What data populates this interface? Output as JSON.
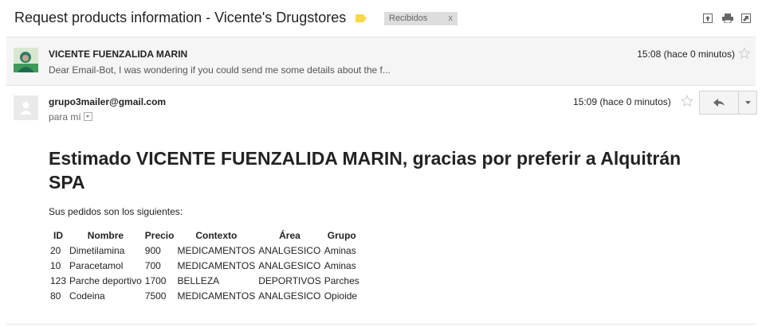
{
  "subject": "Request products information - Vicente's Drugstores",
  "label": {
    "name": "Recibidos",
    "close": "x"
  },
  "colors": {
    "label_tag": "#f9d84a",
    "star": "#cfcfcf",
    "chip_bg": "#dddddd"
  },
  "icons": [
    "new-window-icon",
    "print-icon",
    "popout-icon",
    "star-icon",
    "reply-icon",
    "chevron-down-icon"
  ],
  "thread": [
    {
      "sender": "VICENTE FUENZALIDA MARIN",
      "time": "15:08 (hace 0 minutos)",
      "snippet": "Dear Email-Bot, I was wondering if you could send me some details about the f..."
    },
    {
      "sender": "grupo3mailer@gmail.com",
      "time": "15:09 (hace 0 minutos)",
      "to": "para mí"
    }
  ],
  "body": {
    "heading": "Estimado VICENTE FUENZALIDA MARIN, gracias por preferir a Alquitrán SPA",
    "intro": "Sus pedidos son los siguientes:",
    "table": {
      "headers": [
        "ID",
        "Nombre",
        "Precio",
        "Contexto",
        "Área",
        "Grupo"
      ],
      "rows": [
        [
          "20",
          "Dimetilamina",
          "900",
          "MEDICAMENTOS",
          "ANALGESICO",
          "Aminas"
        ],
        [
          "10",
          "Paracetamol",
          "700",
          "MEDICAMENTOS",
          "ANALGESICO",
          "Aminas"
        ],
        [
          "123",
          "Parche deportivo",
          "1700",
          "BELLEZA",
          "DEPORTIVOS",
          "Parches"
        ],
        [
          "80",
          "Codeina",
          "7500",
          "MEDICAMENTOS",
          "ANALGESICO",
          "Opioide"
        ]
      ]
    }
  }
}
